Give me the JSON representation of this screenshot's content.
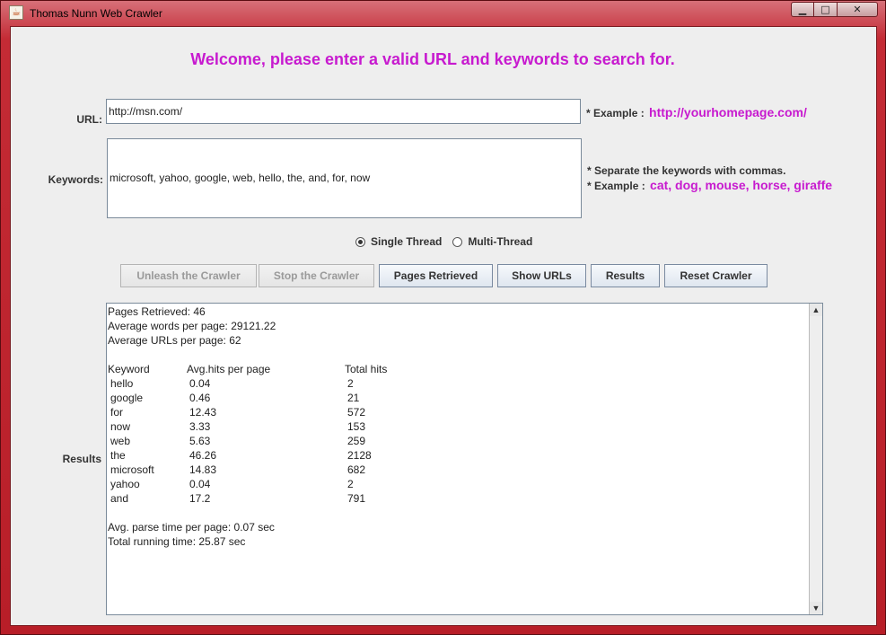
{
  "window": {
    "title": "Thomas Nunn Web Crawler",
    "app_icon": "java-icon",
    "controls": {
      "minimize": "▁",
      "maximize": "□",
      "close": "✕"
    }
  },
  "welcome": "Welcome, please enter a valid URL and keywords to search for.",
  "url": {
    "label": "URL:",
    "value": "http://msn.com/",
    "hint_prefix": "* Example :",
    "hint_value": "http://yourhomepage.com/"
  },
  "keywords": {
    "label": "Keywords:",
    "value": "microsoft, yahoo, google, web, hello, the, and, for, now",
    "hint1": "* Separate the keywords with commas.",
    "hint2_prefix": "* Example :",
    "hint2_value": "cat, dog, mouse, horse, giraffe"
  },
  "mode": {
    "single": "Single Thread",
    "multi": "Multi-Thread",
    "selected": "single"
  },
  "buttons": {
    "unleash": "Unleash the Crawler",
    "stop": "Stop the Crawler",
    "pages": "Pages Retrieved",
    "urls": "Show URLs",
    "results": "Results",
    "reset": "Reset Crawler"
  },
  "results": {
    "label": "Results",
    "summary": [
      "Pages Retrieved: 46",
      "Average words per page: 29121.22",
      "Average URLs per page: 62"
    ],
    "table_header": {
      "keyword": "Keyword",
      "avg": "Avg.hits per page",
      "total": "Total hits"
    },
    "rows": [
      {
        "keyword": "hello",
        "avg": "0.04",
        "total": "2"
      },
      {
        "keyword": "google",
        "avg": "0.46",
        "total": "21"
      },
      {
        "keyword": "for",
        "avg": "12.43",
        "total": "572"
      },
      {
        "keyword": "now",
        "avg": "3.33",
        "total": "153"
      },
      {
        "keyword": "web",
        "avg": "5.63",
        "total": "259"
      },
      {
        "keyword": "the",
        "avg": "46.26",
        "total": "2128"
      },
      {
        "keyword": "microsoft",
        "avg": "14.83",
        "total": "682"
      },
      {
        "keyword": "yahoo",
        "avg": "0.04",
        "total": "2"
      },
      {
        "keyword": "and",
        "avg": "17.2",
        "total": "791"
      }
    ],
    "footer": [
      "Avg. parse time per page: 0.07 sec",
      "Total running time: 25.87 sec"
    ]
  },
  "colors": {
    "accent": "#c71acf",
    "frame": "#c1232d"
  }
}
